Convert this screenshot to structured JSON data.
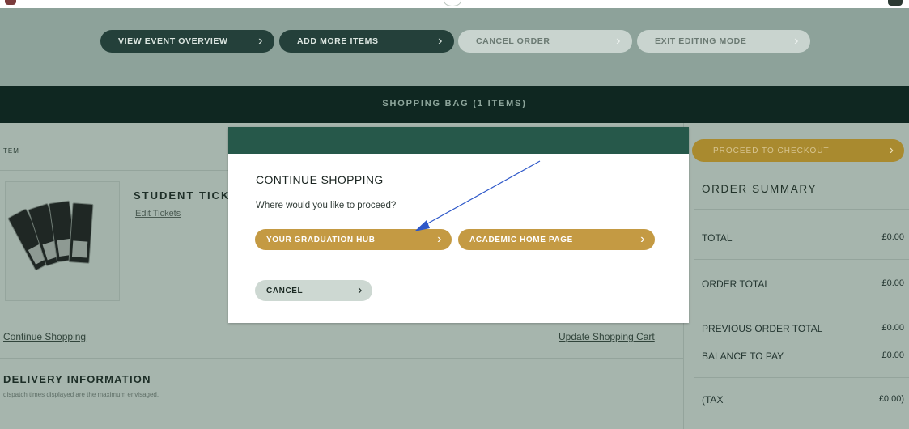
{
  "nav": {
    "view_event_overview": "VIEW EVENT OVERVIEW",
    "add_more_items": "ADD MORE ITEMS",
    "cancel_order": "CANCEL ORDER",
    "exit_editing_mode": "EXIT EDITING MODE"
  },
  "bag": {
    "title": "SHOPPING BAG (1 ITEMS)"
  },
  "cart": {
    "item_header": "TEM",
    "item_title": "STUDENT TICKE",
    "edit_tickets": "Edit Tickets",
    "continue_shopping": "Continue Shopping",
    "update_cart": "Update Shopping Cart",
    "delivery_title": "DELIVERY INFORMATION",
    "delivery_note": "dispatch times displayed are the maximum envisaged."
  },
  "summary": {
    "checkout_label": "PROCEED TO CHECKOUT",
    "title": "ORDER SUMMARY",
    "rows": [
      {
        "label": "TOTAL",
        "value": "£0.00"
      },
      {
        "label": "ORDER TOTAL",
        "value": "£0.00"
      },
      {
        "label": "PREVIOUS ORDER TOTAL",
        "value": "£0.00"
      },
      {
        "label": "BALANCE TO PAY",
        "value": "£0.00"
      },
      {
        "label": "(TAX",
        "value": "£0.00)"
      }
    ]
  },
  "modal": {
    "title": "CONTINUE SHOPPING",
    "question": "Where would you like to proceed?",
    "graduation_hub": "YOUR GRADUATION HUB",
    "academic_home": "ACADEMIC HOME PAGE",
    "cancel": "CANCEL"
  },
  "icons": {
    "chevron": "›"
  },
  "colors": {
    "dark_green": "#24403a",
    "header_green": "#26584a",
    "gold": "#c49a43",
    "annotation_arrow": "#2e58c9"
  }
}
